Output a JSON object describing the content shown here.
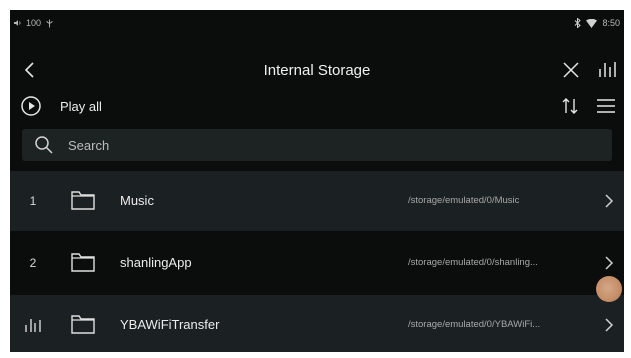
{
  "status_bar": {
    "volume": "100",
    "time": "8:50",
    "icons": [
      "volume-icon",
      "usb-icon",
      "bluetooth-icon",
      "wifi-icon"
    ]
  },
  "header": {
    "title": "Internal Storage",
    "back_icon": "back-arrow-icon",
    "close_icon": "close-icon",
    "equalizer_icon": "equalizer-icon"
  },
  "toolbar": {
    "play_all_label": "Play all",
    "sort_icon": "sort-icon",
    "list_view_icon": "list-view-icon"
  },
  "search": {
    "placeholder": "Search"
  },
  "folders": [
    {
      "index": "1",
      "name": "Music",
      "path": "/storage/emulated/0/Music",
      "playing": false
    },
    {
      "index": "2",
      "name": "shanlingApp",
      "path": "/storage/emulated/0/shanling...",
      "playing": false
    },
    {
      "index": "",
      "name": "YBAWiFiTransfer",
      "path": "/storage/emulated/0/YBAWiFi...",
      "playing": true
    }
  ],
  "colors": {
    "background": "#0b0d0d",
    "row_alt": "#1b2122",
    "search_bg": "#1d2223",
    "text": "#ececec",
    "muted": "#a8a8a8"
  }
}
